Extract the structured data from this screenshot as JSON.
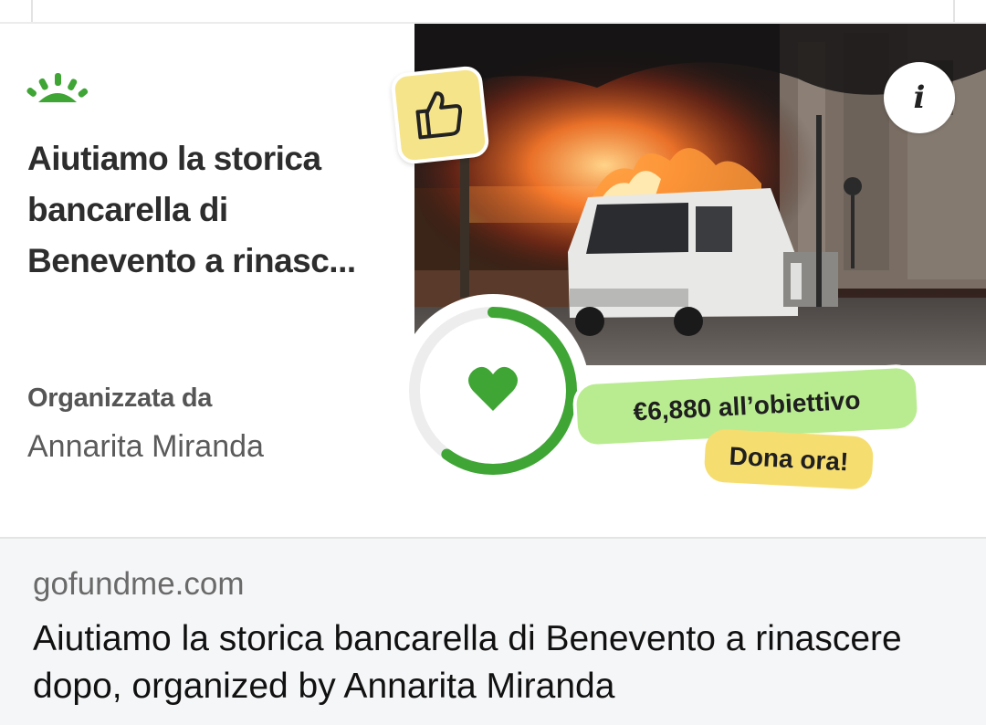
{
  "card": {
    "title": "Aiutiamo la storica bancarella di Benevento a rinasc...",
    "organizer_label": "Organizzata da",
    "organizer_name": "Annarita Miranda",
    "goal_text": "€6,880 all’obiettivo",
    "donate_label": "Dona ora!",
    "info_label": "i",
    "progress": 0.6
  },
  "link_preview": {
    "domain": "gofundme.com",
    "title": "Aiutiamo la storica bancarella di Benevento a rinascere dopo, organized by Annarita Miranda"
  },
  "colors": {
    "brand_green": "#3fa535",
    "goal_pill": "#b9ec90",
    "donate_pill": "#f6dd70",
    "thumb_badge": "#f6e48a"
  },
  "icons": [
    "gofundme-logo-icon",
    "thumbs-up-icon",
    "info-icon",
    "heart-icon"
  ]
}
